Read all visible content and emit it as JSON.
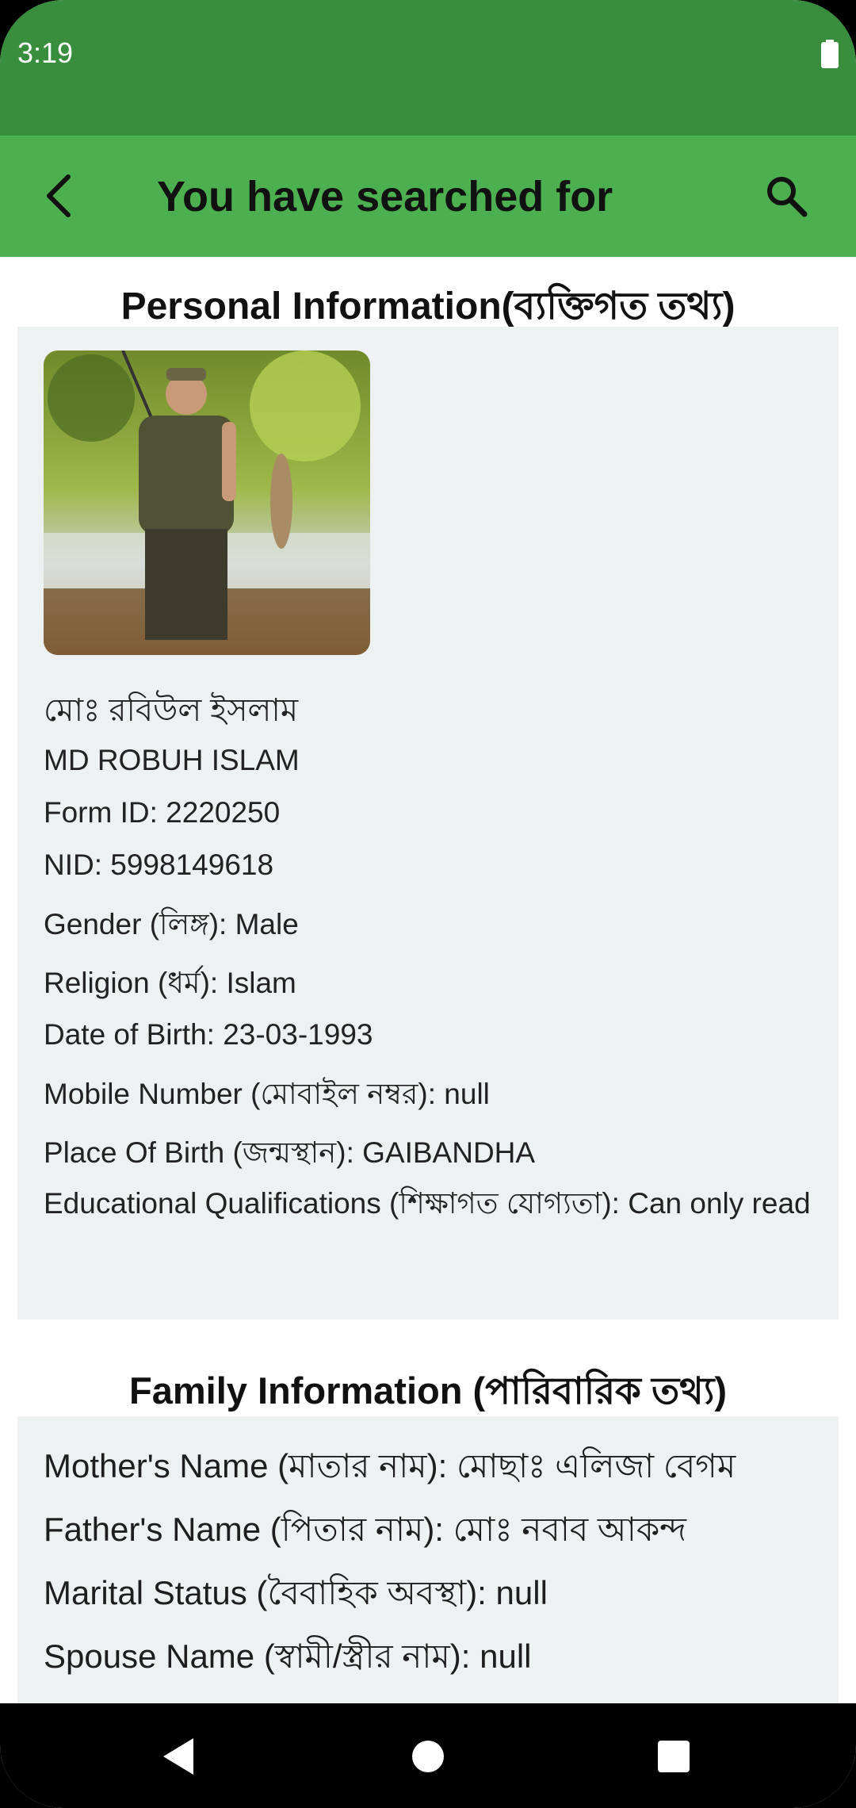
{
  "status_bar": {
    "time": "3:19"
  },
  "app_bar": {
    "title": "You have searched for"
  },
  "personal": {
    "heading": "Personal Information(ব্যক্তিগত তথ্য)",
    "name_bn": "মোঃ রবিউল ইসলাম",
    "name_en": "MD ROBUH ISLAM",
    "form_id": "Form ID: 2220250",
    "nid": "NID: 5998149618",
    "gender": "Gender (লিঙ্গ): Male",
    "religion": "Religion (ধর্ম): Islam",
    "dob": "Date of Birth: 23-03-1993",
    "mobile": "Mobile Number (মোবাইল নম্বর): null",
    "place_of_birth": "Place Of Birth (জন্মস্থান): GAIBANDHA",
    "education": "Educational Qualifications (শিক্ষাগত যোগ্যতা): Can only read"
  },
  "family": {
    "heading": "Family Information (পারিবারিক তথ্য)",
    "mother": "Mother's Name (মাতার নাম): মোছাঃ এলিজা বেগম",
    "father": "Father's Name (পিতার নাম): মোঃ নবাব আকন্দ",
    "marital": "Marital Status (বৈবাহিক অবস্থা): null",
    "spouse": "Spouse Name (স্বামী/স্ত্রীর নাম): null"
  },
  "colors": {
    "status_bar": "#388e3c",
    "app_bar": "#4caf50",
    "card_bg": "#eef1f2"
  },
  "icons": {
    "back": "back-arrow-icon",
    "search": "search-icon",
    "battery": "battery-icon",
    "nav_back": "nav-back-icon",
    "nav_home": "nav-home-icon",
    "nav_recents": "nav-recents-icon"
  }
}
